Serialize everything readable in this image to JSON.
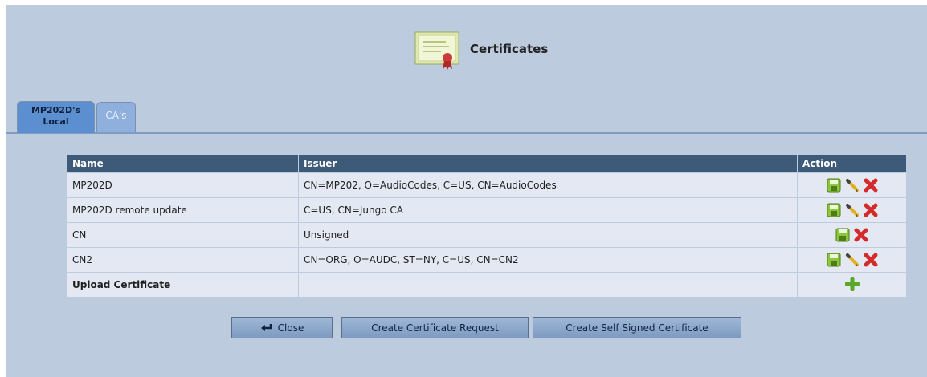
{
  "header": {
    "title": "Certificates",
    "icon": "certificate-icon"
  },
  "tabs": [
    {
      "line1": "MP202D's",
      "line2": "Local",
      "active": true
    },
    {
      "label": "CA's",
      "active": false
    }
  ],
  "table": {
    "columns": [
      "Name",
      "Issuer",
      "Action"
    ],
    "rows": [
      {
        "name": "MP202D",
        "issuer": "CN=MP202, O=AudioCodes, C=US, CN=AudioCodes",
        "actions": [
          "save-icon",
          "edit-icon",
          "delete-icon"
        ]
      },
      {
        "name": "MP202D remote update",
        "issuer": "C=US, CN=Jungo CA",
        "actions": [
          "save-icon",
          "edit-icon",
          "delete-icon"
        ]
      },
      {
        "name": "CN",
        "issuer": "Unsigned",
        "actions": [
          "save-icon",
          "delete-icon"
        ]
      },
      {
        "name": "CN2",
        "issuer": "CN=ORG, O=AUDC, ST=NY, C=US, CN=CN2",
        "actions": [
          "save-icon",
          "edit-icon",
          "delete-icon"
        ]
      }
    ],
    "upload": {
      "label": "Upload Certificate",
      "action": "add-icon"
    }
  },
  "buttons": {
    "close": "Close",
    "create_request": "Create Certificate Request",
    "create_self_signed": "Create Self Signed Certificate"
  },
  "colors": {
    "background": "#bccbde",
    "header_row": "#3d5a78",
    "row": "#e3e8f2",
    "tab_active": "#5c8fd0",
    "tab_inactive": "#8fb0dd",
    "button": "#8ea9cd"
  }
}
